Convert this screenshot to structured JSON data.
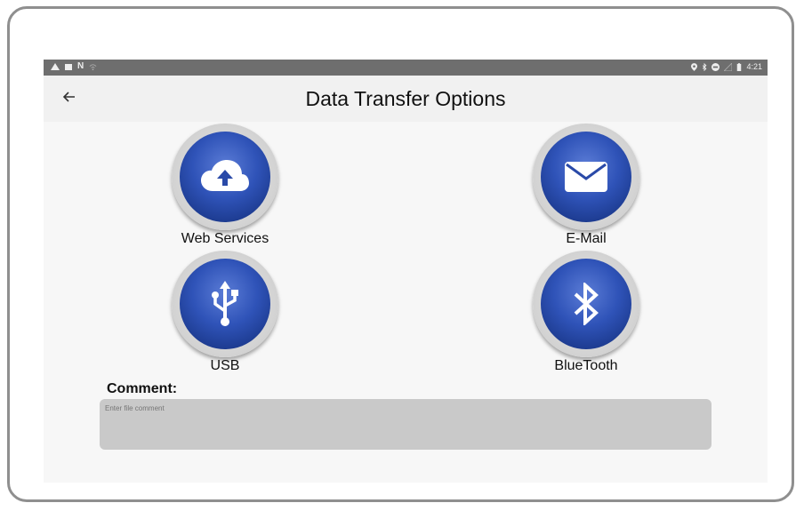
{
  "statusbar": {
    "left_icons": [
      "warning-icon",
      "image-icon",
      "n-icon",
      "wifi-off-icon"
    ],
    "right_icons": [
      "location-icon",
      "bluetooth-icon",
      "do-not-disturb-icon",
      "signal-icon",
      "battery-icon"
    ],
    "time": "4:21"
  },
  "header": {
    "back_icon": "arrow-left-icon",
    "title": "Data Transfer Options"
  },
  "options": {
    "web_services": {
      "label": "Web Services",
      "icon": "cloud-upload-icon"
    },
    "email": {
      "label": "E-Mail",
      "icon": "envelope-icon"
    },
    "usb": {
      "label": "USB",
      "icon": "usb-icon"
    },
    "bluetooth": {
      "label": "BlueTooth",
      "icon": "bluetooth-icon"
    }
  },
  "comment": {
    "label": "Comment:",
    "placeholder": "Enter file comment",
    "value": ""
  },
  "colors": {
    "accent_blue": "#2f53b8",
    "statusbar": "#6e6e6e",
    "input_bg": "#c9c9c9"
  }
}
